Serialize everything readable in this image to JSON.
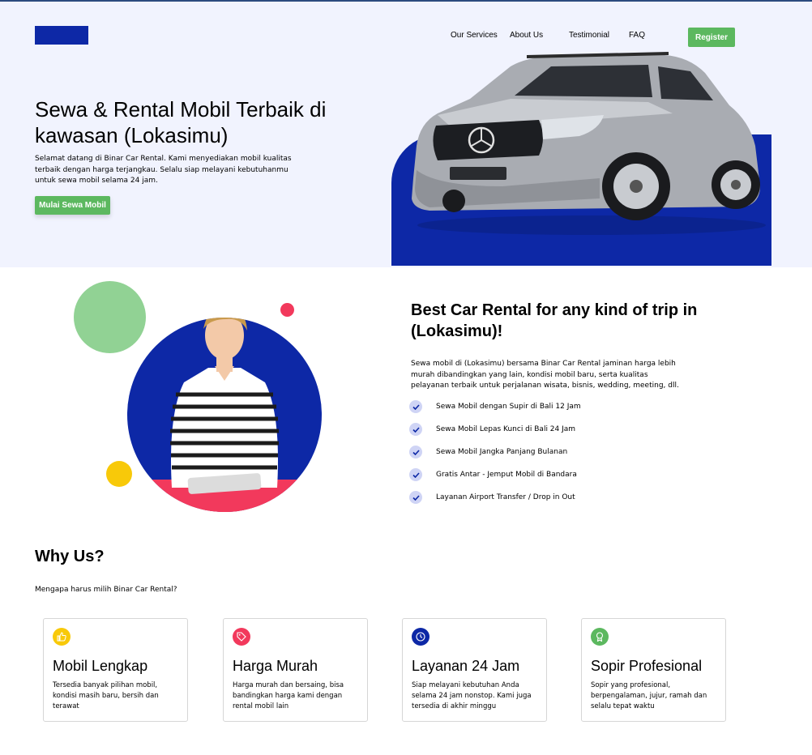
{
  "nav": {
    "items": [
      "Our Services",
      "About Us",
      "Testimonial",
      "FAQ"
    ],
    "register_label": "Register"
  },
  "hero": {
    "title": "Sewa & Rental Mobil Terbaik di kawasan (Lokasimu)",
    "description": "Selamat datang di Binar Car Rental. Kami menyediakan mobil kualitas terbaik dengan harga terjangkau. Selalu siap melayani kebutuhanmu untuk sewa mobil selama 24 jam.",
    "cta_label": "Mulai Sewa Mobil"
  },
  "services": {
    "title": "Best Car Rental for any kind of trip in (Lokasimu)!",
    "description": "Sewa mobil di (Lokasimu) bersama Binar Car Rental jaminan harga lebih murah dibandingkan yang lain, kondisi mobil baru, serta kualitas pelayanan terbaik untuk perjalanan wisata, bisnis, wedding, meeting, dll.",
    "list": [
      "Sewa Mobil dengan Supir di Bali 12 Jam",
      "Sewa Mobil Lepas Kunci di Bali 24 Jam",
      "Sewa Mobil Jangka Panjang Bulanan",
      "Gratis Antar - Jemput Mobil di Bandara",
      "Layanan Airport Transfer / Drop in Out"
    ]
  },
  "why": {
    "title": "Why Us?",
    "subtitle": "Mengapa harus milih Binar Car Rental?",
    "cards": [
      {
        "icon": "thumbs-up-icon",
        "color": "#f8c909",
        "title": "Mobil Lengkap",
        "desc": "Tersedia banyak pilihan mobil, kondisi masih baru, bersih dan terawat"
      },
      {
        "icon": "tag-icon",
        "color": "#f2395c",
        "title": "Harga Murah",
        "desc": "Harga murah dan bersaing, bisa bandingkan harga kami dengan rental mobil lain"
      },
      {
        "icon": "clock-icon",
        "color": "#0d28a6",
        "title": "Layanan 24 Jam",
        "desc": "Siap melayani kebutuhan Anda selama 24 jam nonstop. Kami juga tersedia di akhir minggu"
      },
      {
        "icon": "award-icon",
        "color": "#5cb85f",
        "title": "Sopir Profesional",
        "desc": "Sopir yang profesional, berpengalaman, jujur, ramah dan selalu tepat waktu"
      }
    ]
  },
  "colors": {
    "primary": "#0d28a6",
    "accent_green": "#5cb85f",
    "hero_bg": "#f1f3fe"
  }
}
